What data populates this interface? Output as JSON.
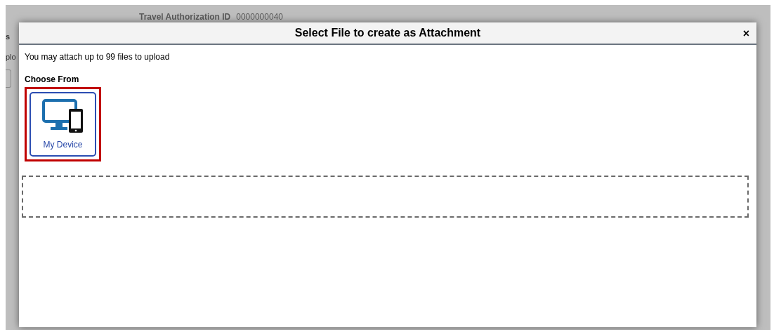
{
  "background": {
    "field_label": "Travel Authorization ID",
    "field_value": "0000000040",
    "cut_texts": [
      "s",
      "plo"
    ]
  },
  "dialog": {
    "title": "Select File to create as Attachment",
    "close": "×",
    "note": "You may attach up to 99 files to upload",
    "choose_label": "Choose From",
    "sources": [
      {
        "label": "My Device",
        "highlighted": true
      }
    ]
  }
}
